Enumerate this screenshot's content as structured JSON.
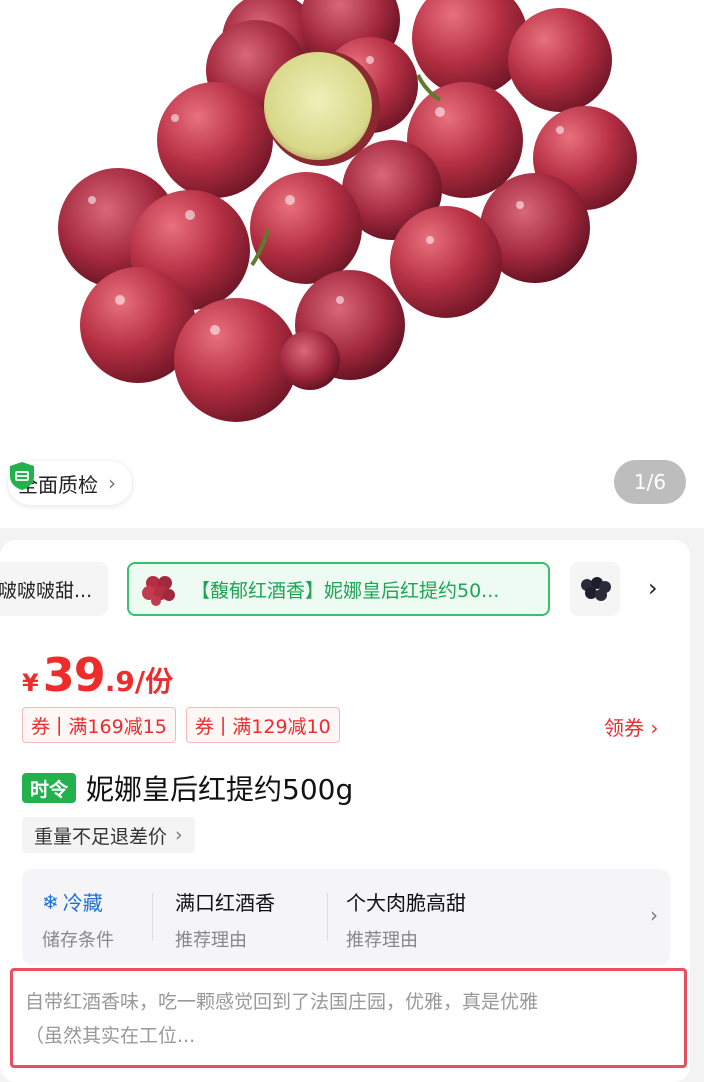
{
  "hero": {
    "quality_label": "全面质检",
    "pager": "1/6"
  },
  "variants": {
    "items": [
      {
        "label": "啵啵啵甜..."
      },
      {
        "label": "【馥郁红酒香】妮娜皇后红提约50..."
      },
      {
        "label": ""
      }
    ],
    "more_icon": "chevron-right-icon"
  },
  "price": {
    "currency": "¥",
    "integer": "39",
    "decimal": ".9",
    "unit": "/份"
  },
  "coupons": [
    {
      "tag": "券",
      "text": "满169减15"
    },
    {
      "tag": "券",
      "text": "满129减10"
    }
  ],
  "get_coupon": "领券 ›",
  "product": {
    "season_badge": "时令",
    "title": "妮娜皇后红提约500g",
    "weight_note": "重量不足退差价"
  },
  "attributes": [
    {
      "value": "冷藏",
      "label": "储存条件",
      "icon": "snowflake-icon"
    },
    {
      "value": "满口红酒香",
      "label": "推荐理由"
    },
    {
      "value": "个大肉脆高甜",
      "label": "推荐理由"
    }
  ],
  "review": {
    "text_line1": "自带红酒香味，吃一颗感觉回到了法国庄园，优雅，真是优雅",
    "text_line2": "（虽然其实在工位..."
  },
  "colors": {
    "price_red": "#ee2c2c",
    "accent_green": "#22b14c",
    "highlight_border": "#e85060",
    "storage_blue": "#1c6fd6"
  }
}
